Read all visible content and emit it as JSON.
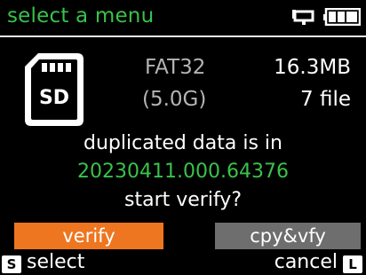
{
  "header": {
    "title": "select a menu",
    "status_icons": [
      "usb-connected-icon",
      "battery-icon"
    ],
    "battery_level": 0.8
  },
  "card": {
    "icon": "sd-card-icon",
    "icon_label": "SD",
    "filesystem": "FAT32",
    "used": "(5.0G)",
    "size": "16.3MB",
    "file_count": "7 file"
  },
  "message": {
    "line1": "duplicated data is in",
    "folder": "20230411.000.64376",
    "line3": "start verify?"
  },
  "buttons": {
    "verify_label": "verify",
    "copy_verify_label": "cpy&vfy"
  },
  "footer": {
    "select_key": "S",
    "select_label": "select",
    "cancel_label": "cancel",
    "cancel_key": "L"
  },
  "colors": {
    "accent_green": "#39c24b",
    "verify_orange": "#ee7620",
    "secondary_gray": "#6e6e6e",
    "muted_text": "#b4b4b4"
  }
}
